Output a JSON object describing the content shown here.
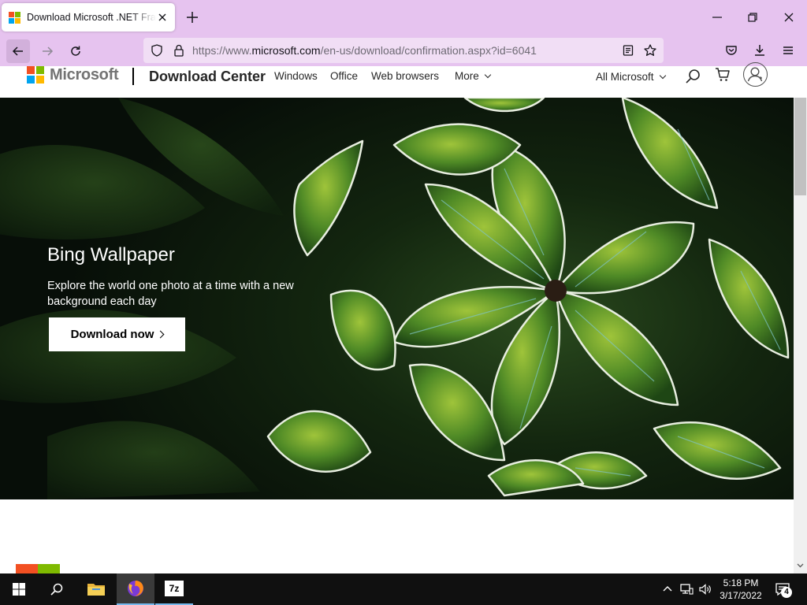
{
  "colors": {
    "chrome_bg": "#e6c3ef",
    "urlbar_bg": "#f1def5",
    "ms_red": "#f25022",
    "ms_green": "#7fba00",
    "ms_blue": "#00a4ef",
    "ms_yellow": "#ffb900",
    "taskbar_bg": "#101010"
  },
  "browser": {
    "tab_title": "Download Microsoft .NET Framework",
    "tab_icon": "microsoft-logo-icon",
    "url_prefix": "https://www.",
    "url_host": "microsoft.com",
    "url_path": "/en-us/download/confirmation.aspx?id=6041"
  },
  "header": {
    "brand": "Microsoft",
    "title": "Download Center",
    "nav": [
      "Windows",
      "Office",
      "Web browsers",
      "More"
    ],
    "all_microsoft": "All Microsoft"
  },
  "hero": {
    "title": "Bing Wallpaper",
    "description": "Explore the world one photo at a time with a new background each day",
    "button": "Download now"
  },
  "taskbar": {
    "time": "5:18 PM",
    "date": "3/17/2022",
    "notifications": "4",
    "sevenzip_label": "7z"
  }
}
